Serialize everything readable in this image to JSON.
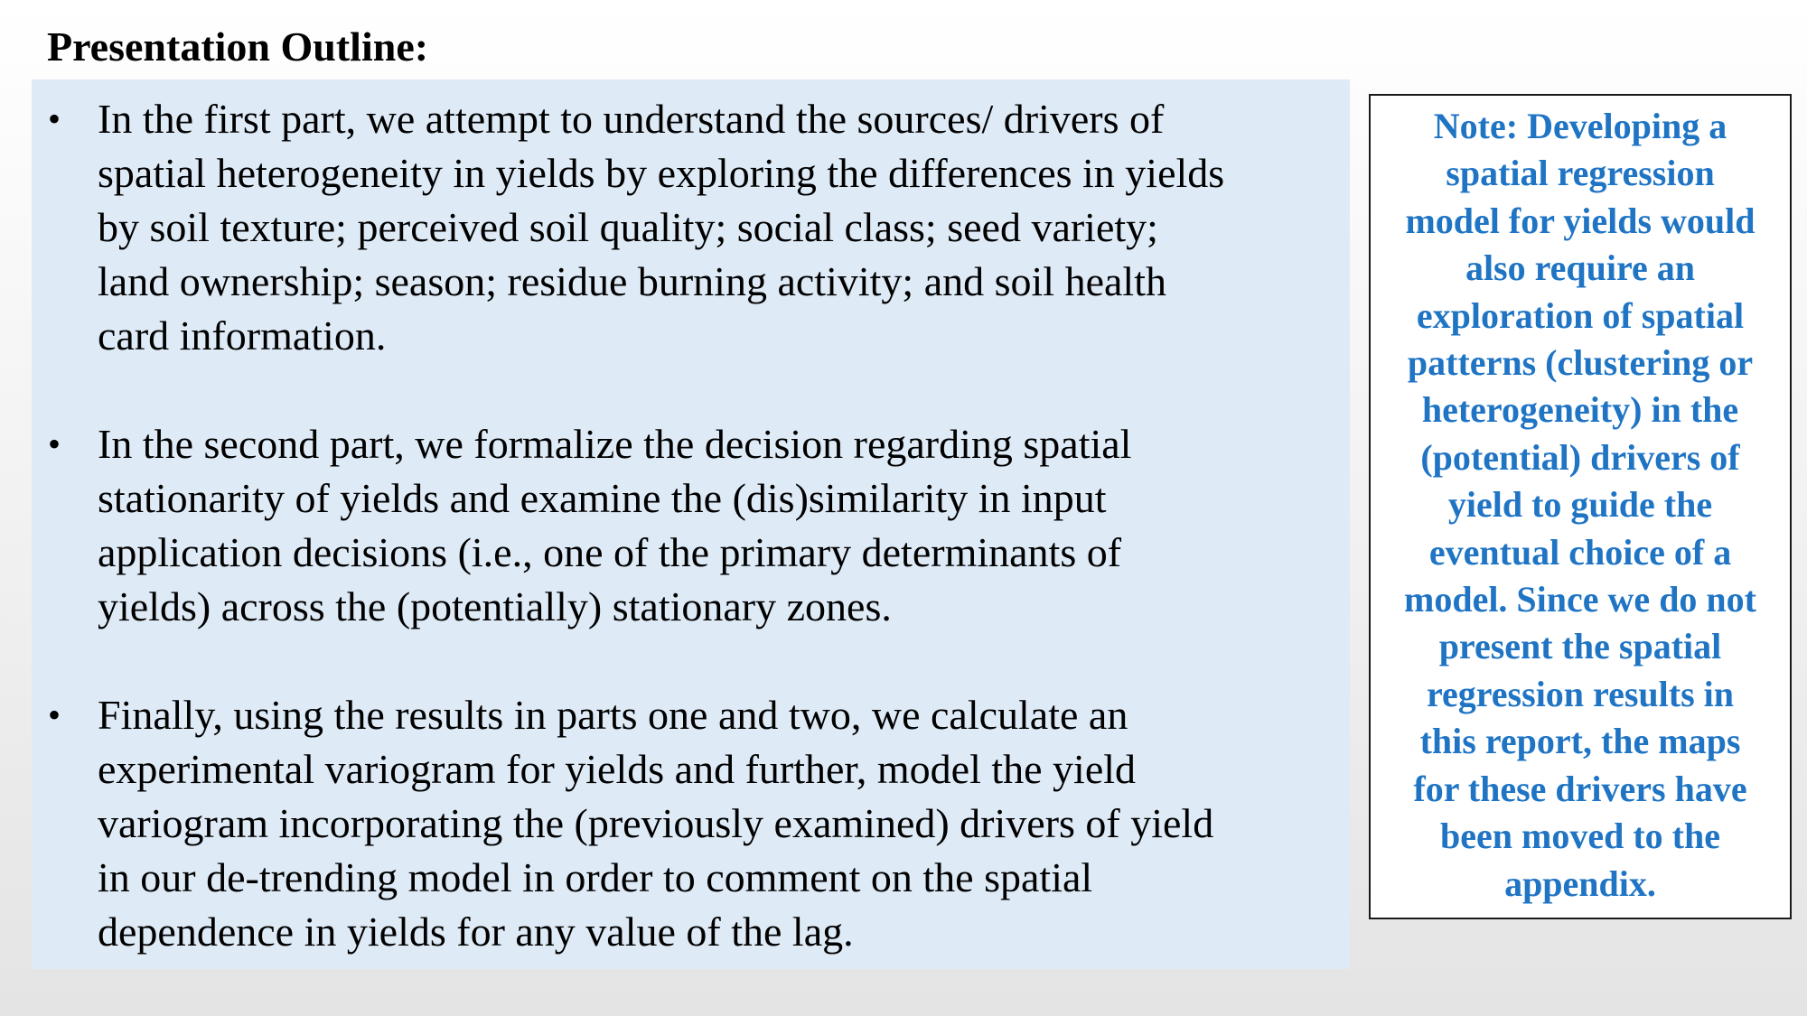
{
  "slide": {
    "title": "Presentation Outline:",
    "bullet_symbol": "•",
    "bullets": [
      {
        "lines": [
          "In the first part, we attempt to understand the sources/ drivers of",
          "spatial heterogeneity in yields by exploring the differences in yields",
          "by soil texture; perceived soil quality; social class; seed variety;",
          "land ownership; season; residue burning activity; and soil health",
          "card information."
        ]
      },
      {
        "lines": [
          "In the second part, we formalize the decision regarding spatial",
          "stationarity of yields and examine the (dis)similarity in input",
          "application decisions (i.e., one of the primary determinants of",
          "yields) across the (potentially) stationary zones."
        ]
      },
      {
        "lines": [
          "Finally, using the results in parts one and two, we calculate an",
          "experimental variogram for yields and further, model the yield",
          "variogram incorporating the (previously examined) drivers of yield",
          "in our de-trending model in order to comment on the spatial",
          "dependence in yields for any value of the lag."
        ]
      }
    ],
    "note": {
      "lines": [
        "Note: Developing a",
        "spatial regression",
        "model for yields would",
        "also require an",
        "exploration of spatial",
        "patterns (clustering or",
        "heterogeneity) in the",
        "(potential) drivers of",
        "yield to guide the",
        "eventual choice of a",
        "model. Since we do not",
        "present the spatial",
        "regression results in",
        "this report, the maps",
        "for these drivers have",
        "been moved to the",
        "appendix."
      ]
    },
    "colors": {
      "outline_box_background": "#deeaf6",
      "note_text": "#1f74c4",
      "note_border": "#1a1a1a",
      "title_text": "#000000"
    }
  }
}
